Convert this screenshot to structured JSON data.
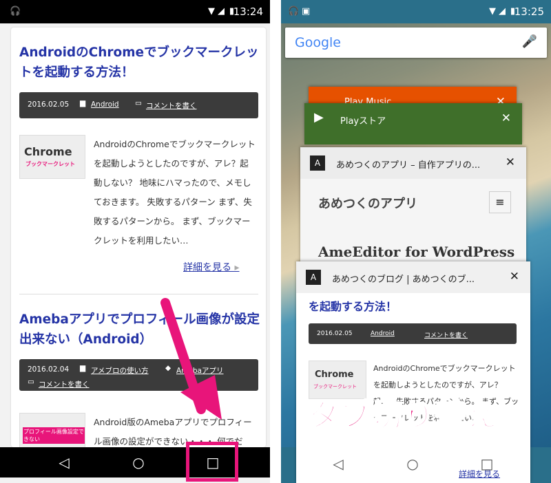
{
  "left": {
    "status": {
      "time": "13:24"
    },
    "article1": {
      "title": "AndroidのChromeでブックマークレットを起動する方法！",
      "date": "2016.02.05",
      "category": "Android",
      "comment": "コメントを書く",
      "thumb_main": "Chrome",
      "thumb_sub": "ブックマークレット",
      "excerpt": "AndroidのChromeでブックマークレットを起動しようとしたのですが、アレ？起動しない？ 地味にハマったので、メモしておきます。 失敗するパターン まず、失敗するパターンから。 まず、ブックマークレットを利用したい…",
      "more": "詳細を見る"
    },
    "article2": {
      "title": "Amebaアプリでプロフィール画像が設定出来ない（Android）",
      "date": "2016.02.04",
      "category": "アメブロの使い方",
      "tag": "Amebaアプリ",
      "comment": "コメントを書く",
      "thumb_sub": "プロフィール画像設定できない",
      "excerpt": "Android版のAmebaアプリでプロフィール画像の設定ができない・・・ 何でだ"
    }
  },
  "right": {
    "status": {
      "time": "13:25"
    },
    "search": {
      "logo": "Google"
    },
    "cards": [
      {
        "label": "Play Music",
        "color": "#e65100"
      },
      {
        "label": "Playストア",
        "color": "#3f6f2a"
      },
      {
        "label": "あめつくのアプリ – 自作アプリの...",
        "body_title": "あめつくのアプリ",
        "body_sub": "AmeEditor for WordPress"
      },
      {
        "label": "あめつくのブログ | あめつくのブ...",
        "body_title": "を起動する方法！",
        "date": "2016.02.05",
        "category": "Android",
        "comment": "コメントを書く",
        "thumb_main": "Chrome",
        "thumb_sub": "ブックマークレット",
        "excerpt": "AndroidのChromeでブックマークレットを起動しようとしたのですが、アレ？起…、失敗するパターンから。 まず、ブックマークレットを利用したい…",
        "more": "詳細を見る"
      }
    ],
    "overlay": "タブ切り替え"
  },
  "colors": {
    "accent": "#e8157a",
    "link": "#2534a6"
  }
}
